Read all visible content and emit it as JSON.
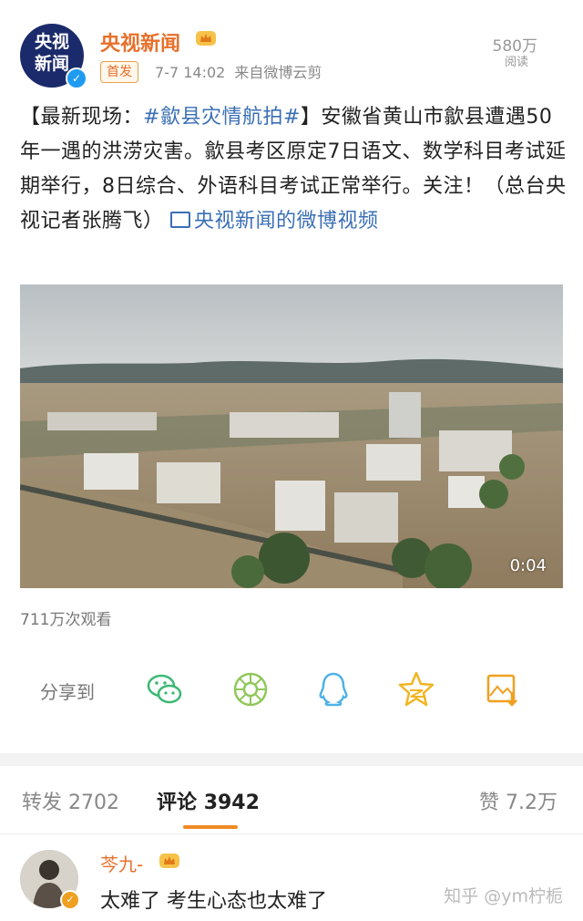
{
  "post": {
    "author": "央视新闻",
    "avatar_text_line1": "央视",
    "avatar_text_line2": "新闻",
    "badge": "首发",
    "time": "7-7 14:02",
    "source": "来自微博云剪",
    "reads": "580万",
    "reads_label": "阅读",
    "text": {
      "bracket_open": "【最新现场：",
      "topic": "#歙县灾情航拍#",
      "body": "】安徽省黄山市歙县遭遇50年一遇的洪涝灾害。歙县考区原定7日语文、数学科目考试延期举行，8日综合、外语科目考试正常举行。关注！（总台央视记者张腾飞）",
      "video_link": "央视新闻的微博视频"
    },
    "video": {
      "duration": "0:04"
    },
    "views": "711万次观看"
  },
  "share": {
    "label": "分享到",
    "icons": [
      "wechat-icon",
      "moments-icon",
      "qq-icon",
      "qzone-star-icon",
      "save-image-icon"
    ]
  },
  "tabs": {
    "repost_label": "转发",
    "repost_count": "2702",
    "comment_label": "评论",
    "comment_count": "3942",
    "like_label": "赞",
    "like_count": "7.2万"
  },
  "comment": {
    "name": "芩九-",
    "text": "太难了 考生心态也太难了"
  },
  "watermark": "知乎 @ym柠栀",
  "colors": {
    "accent_orange": "#e8702a",
    "link_blue": "#3a6fb5",
    "tab_indicator": "#f08a24"
  }
}
